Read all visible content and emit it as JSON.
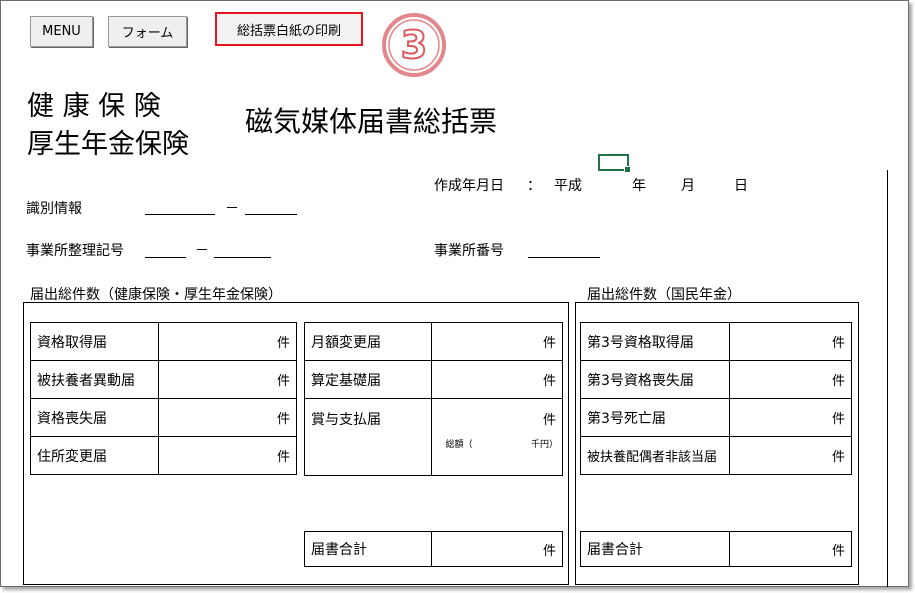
{
  "toolbar": {
    "menu_label": "MENU",
    "form_label": "フォーム",
    "print_label": "総括票白紙の印刷"
  },
  "step_marker": "③",
  "header": {
    "line1": "健 康 保 険",
    "line2": "厚生年金保険",
    "title": "磁気媒体届書総括票"
  },
  "date": {
    "label": "作成年月日",
    "colon": "：",
    "era": "平成",
    "year": "年",
    "month": "月",
    "day": "日"
  },
  "fields": {
    "id_info": "識別情報",
    "dash": "－",
    "office_code": "事業所整理記号",
    "office_number": "事業所番号"
  },
  "sections": {
    "health": "届出総件数（健康保険・厚生年金保険）",
    "national": "届出総件数（国民年金）"
  },
  "unit": "件",
  "health_left": [
    "資格取得届",
    "被扶養者異動届",
    "資格喪失届",
    "住所変更届"
  ],
  "health_right": [
    "月額変更届",
    "算定基礎届",
    "賞与支払届"
  ],
  "bonus_total": {
    "label": "総額（",
    "unit": "千円）"
  },
  "national_rows": [
    "第3号資格取得届",
    "第3号資格喪失届",
    "第3号死亡届",
    "被扶養配偶者非該当届"
  ],
  "total_label": "届書合計",
  "colors": {
    "print_border": "#e5161d",
    "marker": "#e2878b",
    "cell_cursor": "#217346"
  }
}
